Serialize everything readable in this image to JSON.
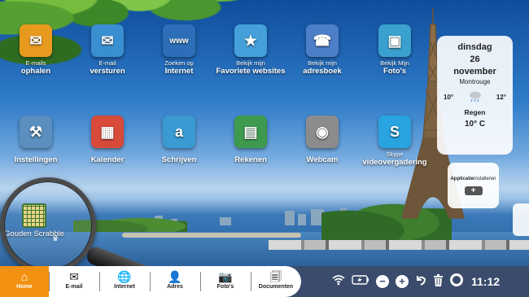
{
  "desktop_icons": [
    {
      "id": "email-ophalen",
      "line1": "E-mails",
      "line2": "ophalen",
      "icon": "download-mail-icon",
      "color": "#e79a1e"
    },
    {
      "id": "email-versturen",
      "line1": "E-mail",
      "line2": "versturen",
      "icon": "envelope-icon",
      "color": "#3a8fd1"
    },
    {
      "id": "internet",
      "line1": "Zoeken op",
      "line2": "Internet",
      "icon": "globe-www-icon",
      "color": "#2c6fb8"
    },
    {
      "id": "favorieten",
      "line1": "Bekijk mijn",
      "line2": "Favoriete websites",
      "icon": "globe-star-icon",
      "color": "#45a0d9"
    },
    {
      "id": "adresboek",
      "line1": "Bekijk mijn",
      "line2": "adresboek",
      "icon": "address-book-icon",
      "color": "#4d7fc9"
    },
    {
      "id": "fotos",
      "line1": "Bekijk Mijn",
      "line2": "Foto's",
      "icon": "photo-icon",
      "color": "#3aa0cf"
    },
    {
      "id": "instellingen",
      "line1": "",
      "line2": "Instellingen",
      "icon": "tools-icon",
      "color": "#5a8fc0"
    },
    {
      "id": "kalender",
      "line1": "",
      "line2": "Kalender",
      "icon": "calendar-icon",
      "color": "#d84a3a"
    },
    {
      "id": "schrijven",
      "line1": "",
      "line2": "Schrijven",
      "icon": "document-icon",
      "color": "#3a9bd3"
    },
    {
      "id": "rekenen",
      "line1": "",
      "line2": "Rekenen",
      "icon": "spreadsheet-icon",
      "color": "#3d9a4e"
    },
    {
      "id": "webcam",
      "line1": "",
      "line2": "Webcam",
      "icon": "webcam-icon",
      "color": "#8c8c8c"
    },
    {
      "id": "skype",
      "line1": "Skype",
      "line2": "videovergadering",
      "icon": "skype-icon",
      "color": "#2aa4e0"
    }
  ],
  "weather": {
    "day": "dinsdag",
    "date": "26",
    "month": "november",
    "city": "Montrouge",
    "low": "10°",
    "high": "12°",
    "condition": "Regen",
    "current": "10° C",
    "icon": "rain-cloud-icon"
  },
  "installer": {
    "label_bold": "Applicatie",
    "label_rest": "installeren",
    "button": "+"
  },
  "scrabble": {
    "label": "Gouden Scrabble",
    "icon": "scrabble-board-icon"
  },
  "taskbar": {
    "tabs": [
      {
        "label": "Home",
        "icon": "home-icon",
        "glyph": "⌂"
      },
      {
        "label": "E-mail",
        "icon": "envelope-icon",
        "glyph": "✉"
      },
      {
        "label": "Internet",
        "icon": "globe-icon",
        "glyph": "🌐"
      },
      {
        "label": "Adres",
        "icon": "contacts-icon",
        "glyph": "👤"
      },
      {
        "label": "Foto's",
        "icon": "camera-icon",
        "glyph": "📷"
      },
      {
        "label": "Documenten",
        "icon": "documents-icon",
        "glyph": "🗐"
      }
    ],
    "tray": {
      "wifi": "wifi-icon",
      "battery": "battery-charging-icon",
      "minus": "zoom-out-icon",
      "plus": "zoom-in-icon",
      "undo": "undo-icon",
      "trash": "trash-icon",
      "help": "lifebuoy-icon",
      "time": "11:12"
    }
  }
}
